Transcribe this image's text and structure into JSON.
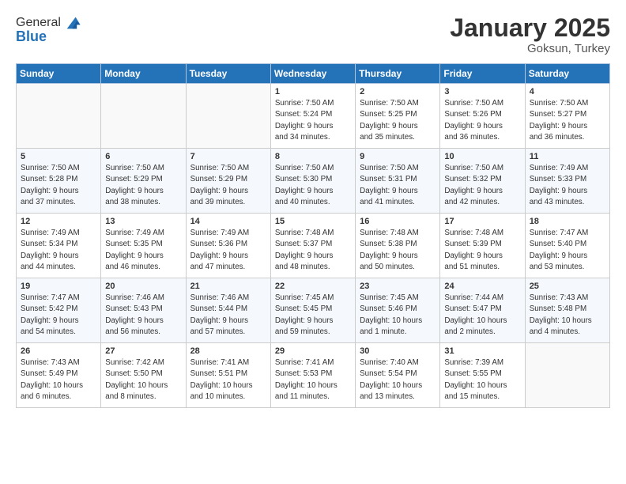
{
  "header": {
    "logo": {
      "general": "General",
      "blue": "Blue"
    },
    "title": "January 2025",
    "location": "Goksun, Turkey"
  },
  "weekdays": [
    "Sunday",
    "Monday",
    "Tuesday",
    "Wednesday",
    "Thursday",
    "Friday",
    "Saturday"
  ],
  "weeks": [
    [
      {
        "day": "",
        "info": ""
      },
      {
        "day": "",
        "info": ""
      },
      {
        "day": "",
        "info": ""
      },
      {
        "day": "1",
        "info": "Sunrise: 7:50 AM\nSunset: 5:24 PM\nDaylight: 9 hours\nand 34 minutes."
      },
      {
        "day": "2",
        "info": "Sunrise: 7:50 AM\nSunset: 5:25 PM\nDaylight: 9 hours\nand 35 minutes."
      },
      {
        "day": "3",
        "info": "Sunrise: 7:50 AM\nSunset: 5:26 PM\nDaylight: 9 hours\nand 36 minutes."
      },
      {
        "day": "4",
        "info": "Sunrise: 7:50 AM\nSunset: 5:27 PM\nDaylight: 9 hours\nand 36 minutes."
      }
    ],
    [
      {
        "day": "5",
        "info": "Sunrise: 7:50 AM\nSunset: 5:28 PM\nDaylight: 9 hours\nand 37 minutes."
      },
      {
        "day": "6",
        "info": "Sunrise: 7:50 AM\nSunset: 5:29 PM\nDaylight: 9 hours\nand 38 minutes."
      },
      {
        "day": "7",
        "info": "Sunrise: 7:50 AM\nSunset: 5:29 PM\nDaylight: 9 hours\nand 39 minutes."
      },
      {
        "day": "8",
        "info": "Sunrise: 7:50 AM\nSunset: 5:30 PM\nDaylight: 9 hours\nand 40 minutes."
      },
      {
        "day": "9",
        "info": "Sunrise: 7:50 AM\nSunset: 5:31 PM\nDaylight: 9 hours\nand 41 minutes."
      },
      {
        "day": "10",
        "info": "Sunrise: 7:50 AM\nSunset: 5:32 PM\nDaylight: 9 hours\nand 42 minutes."
      },
      {
        "day": "11",
        "info": "Sunrise: 7:49 AM\nSunset: 5:33 PM\nDaylight: 9 hours\nand 43 minutes."
      }
    ],
    [
      {
        "day": "12",
        "info": "Sunrise: 7:49 AM\nSunset: 5:34 PM\nDaylight: 9 hours\nand 44 minutes."
      },
      {
        "day": "13",
        "info": "Sunrise: 7:49 AM\nSunset: 5:35 PM\nDaylight: 9 hours\nand 46 minutes."
      },
      {
        "day": "14",
        "info": "Sunrise: 7:49 AM\nSunset: 5:36 PM\nDaylight: 9 hours\nand 47 minutes."
      },
      {
        "day": "15",
        "info": "Sunrise: 7:48 AM\nSunset: 5:37 PM\nDaylight: 9 hours\nand 48 minutes."
      },
      {
        "day": "16",
        "info": "Sunrise: 7:48 AM\nSunset: 5:38 PM\nDaylight: 9 hours\nand 50 minutes."
      },
      {
        "day": "17",
        "info": "Sunrise: 7:48 AM\nSunset: 5:39 PM\nDaylight: 9 hours\nand 51 minutes."
      },
      {
        "day": "18",
        "info": "Sunrise: 7:47 AM\nSunset: 5:40 PM\nDaylight: 9 hours\nand 53 minutes."
      }
    ],
    [
      {
        "day": "19",
        "info": "Sunrise: 7:47 AM\nSunset: 5:42 PM\nDaylight: 9 hours\nand 54 minutes."
      },
      {
        "day": "20",
        "info": "Sunrise: 7:46 AM\nSunset: 5:43 PM\nDaylight: 9 hours\nand 56 minutes."
      },
      {
        "day": "21",
        "info": "Sunrise: 7:46 AM\nSunset: 5:44 PM\nDaylight: 9 hours\nand 57 minutes."
      },
      {
        "day": "22",
        "info": "Sunrise: 7:45 AM\nSunset: 5:45 PM\nDaylight: 9 hours\nand 59 minutes."
      },
      {
        "day": "23",
        "info": "Sunrise: 7:45 AM\nSunset: 5:46 PM\nDaylight: 10 hours\nand 1 minute."
      },
      {
        "day": "24",
        "info": "Sunrise: 7:44 AM\nSunset: 5:47 PM\nDaylight: 10 hours\nand 2 minutes."
      },
      {
        "day": "25",
        "info": "Sunrise: 7:43 AM\nSunset: 5:48 PM\nDaylight: 10 hours\nand 4 minutes."
      }
    ],
    [
      {
        "day": "26",
        "info": "Sunrise: 7:43 AM\nSunset: 5:49 PM\nDaylight: 10 hours\nand 6 minutes."
      },
      {
        "day": "27",
        "info": "Sunrise: 7:42 AM\nSunset: 5:50 PM\nDaylight: 10 hours\nand 8 minutes."
      },
      {
        "day": "28",
        "info": "Sunrise: 7:41 AM\nSunset: 5:51 PM\nDaylight: 10 hours\nand 10 minutes."
      },
      {
        "day": "29",
        "info": "Sunrise: 7:41 AM\nSunset: 5:53 PM\nDaylight: 10 hours\nand 11 minutes."
      },
      {
        "day": "30",
        "info": "Sunrise: 7:40 AM\nSunset: 5:54 PM\nDaylight: 10 hours\nand 13 minutes."
      },
      {
        "day": "31",
        "info": "Sunrise: 7:39 AM\nSunset: 5:55 PM\nDaylight: 10 hours\nand 15 minutes."
      },
      {
        "day": "",
        "info": ""
      }
    ]
  ]
}
